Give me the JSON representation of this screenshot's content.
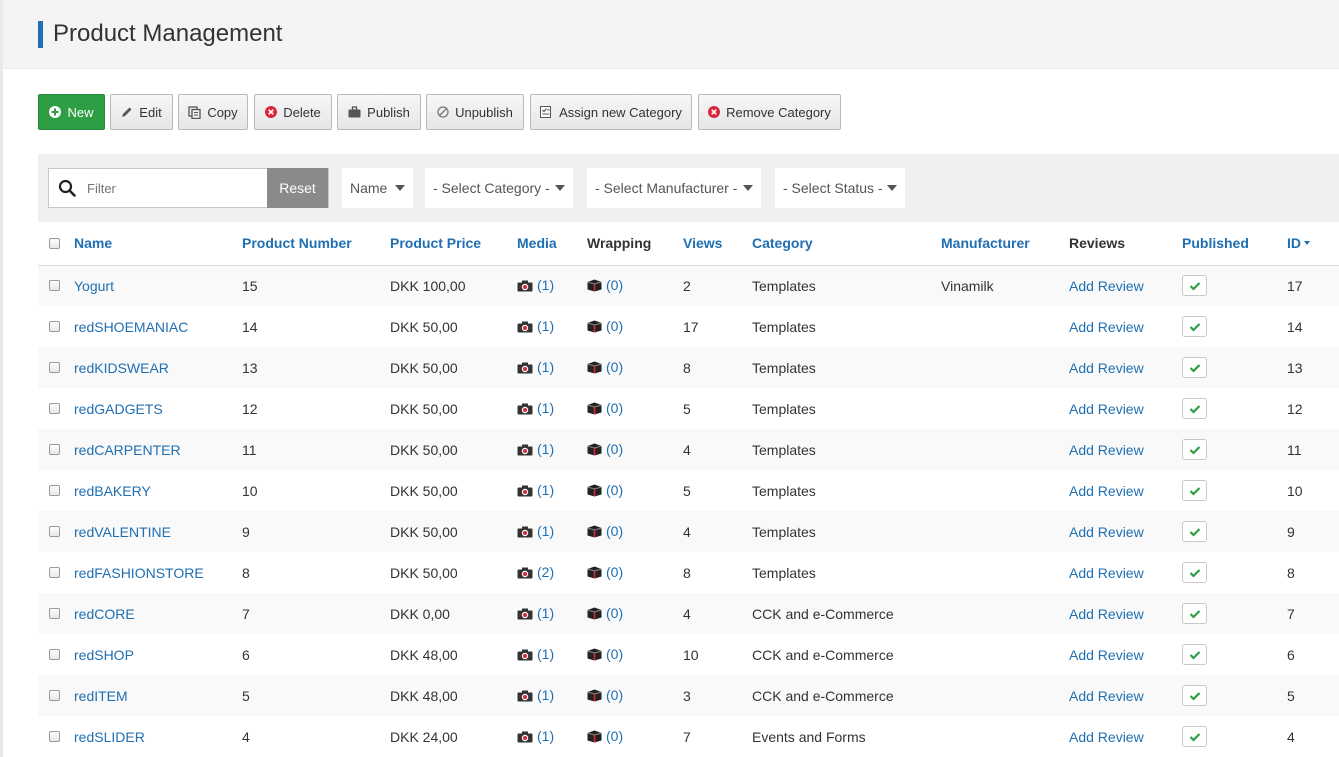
{
  "page": {
    "title": "Product Management"
  },
  "toolbar": {
    "new_label": "New",
    "edit_label": "Edit",
    "copy_label": "Copy",
    "delete_label": "Delete",
    "publish_label": "Publish",
    "unpublish_label": "Unpublish",
    "assign_label": "Assign new Category",
    "remove_label": "Remove Category"
  },
  "filters": {
    "search_placeholder": "Filter",
    "search_value": "",
    "reset_label": "Reset",
    "order_by": "Name",
    "category": "- Select Category -",
    "manufacturer": "- Select Manufacturer -",
    "status": "- Select Status -"
  },
  "table": {
    "headers": {
      "name": "Name",
      "number": "Product Number",
      "price": "Product Price",
      "media": "Media",
      "wrapping": "Wrapping",
      "views": "Views",
      "category": "Category",
      "manufacturer": "Manufacturer",
      "reviews": "Reviews",
      "published": "Published",
      "id": "ID"
    },
    "rows": [
      {
        "name": "Yogurt",
        "number": "15",
        "price": "DKK 100,00",
        "media": "(1)",
        "wrapping": "(0)",
        "views": "2",
        "category": "Templates",
        "manufacturer": "Vinamilk",
        "reviews": "Add Review",
        "id": "17"
      },
      {
        "name": "redSHOEMANIAC",
        "number": "14",
        "price": "DKK 50,00",
        "media": "(1)",
        "wrapping": "(0)",
        "views": "17",
        "category": "Templates",
        "manufacturer": "",
        "reviews": "Add Review",
        "id": "14"
      },
      {
        "name": "redKIDSWEAR",
        "number": "13",
        "price": "DKK 50,00",
        "media": "(1)",
        "wrapping": "(0)",
        "views": "8",
        "category": "Templates",
        "manufacturer": "",
        "reviews": "Add Review",
        "id": "13"
      },
      {
        "name": "redGADGETS",
        "number": "12",
        "price": "DKK 50,00",
        "media": "(1)",
        "wrapping": "(0)",
        "views": "5",
        "category": "Templates",
        "manufacturer": "",
        "reviews": "Add Review",
        "id": "12"
      },
      {
        "name": "redCARPENTER",
        "number": "11",
        "price": "DKK 50,00",
        "media": "(1)",
        "wrapping": "(0)",
        "views": "4",
        "category": "Templates",
        "manufacturer": "",
        "reviews": "Add Review",
        "id": "11"
      },
      {
        "name": "redBAKERY",
        "number": "10",
        "price": "DKK 50,00",
        "media": "(1)",
        "wrapping": "(0)",
        "views": "5",
        "category": "Templates",
        "manufacturer": "",
        "reviews": "Add Review",
        "id": "10"
      },
      {
        "name": "redVALENTINE",
        "number": "9",
        "price": "DKK 50,00",
        "media": "(1)",
        "wrapping": "(0)",
        "views": "4",
        "category": "Templates",
        "manufacturer": "",
        "reviews": "Add Review",
        "id": "9"
      },
      {
        "name": "redFASHIONSTORE",
        "number": "8",
        "price": "DKK 50,00",
        "media": "(2)",
        "wrapping": "(0)",
        "views": "8",
        "category": "Templates",
        "manufacturer": "",
        "reviews": "Add Review",
        "id": "8"
      },
      {
        "name": "redCORE",
        "number": "7",
        "price": "DKK 0,00",
        "media": "(1)",
        "wrapping": "(0)",
        "views": "4",
        "category": "CCK and e-Commerce",
        "manufacturer": "",
        "reviews": "Add Review",
        "id": "7"
      },
      {
        "name": "redSHOP",
        "number": "6",
        "price": "DKK 48,00",
        "media": "(1)",
        "wrapping": "(0)",
        "views": "10",
        "category": "CCK and e-Commerce",
        "manufacturer": "",
        "reviews": "Add Review",
        "id": "6"
      },
      {
        "name": "redITEM",
        "number": "5",
        "price": "DKK 48,00",
        "media": "(1)",
        "wrapping": "(0)",
        "views": "3",
        "category": "CCK and e-Commerce",
        "manufacturer": "",
        "reviews": "Add Review",
        "id": "5"
      },
      {
        "name": "redSLIDER",
        "number": "4",
        "price": "DKK 24,00",
        "media": "(1)",
        "wrapping": "(0)",
        "views": "7",
        "category": "Events and Forms",
        "manufacturer": "",
        "reviews": "Add Review",
        "id": "4"
      }
    ]
  },
  "colors": {
    "link": "#1f6fb2",
    "new_button": "#2e9e44",
    "delete_icon": "#d9263c",
    "publish_check": "#2e9e44"
  }
}
